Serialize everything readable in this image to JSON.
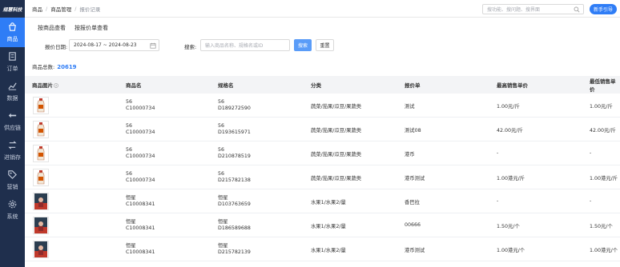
{
  "sidebar": {
    "logo": "规慧科技",
    "items": [
      {
        "label": "商品",
        "icon": "shopping-bag-icon",
        "active": true
      },
      {
        "label": "订单",
        "icon": "order-icon",
        "active": false
      },
      {
        "label": "数据",
        "icon": "chart-line-icon",
        "active": false
      },
      {
        "label": "供应链",
        "icon": "supply-chain-icon",
        "active": false
      },
      {
        "label": "进销存",
        "icon": "inventory-icon",
        "active": false
      },
      {
        "label": "营销",
        "icon": "tag-icon",
        "active": false
      },
      {
        "label": "系统",
        "icon": "gear-icon",
        "active": false
      }
    ]
  },
  "breadcrumb": {
    "items": [
      "商品",
      "商品管理",
      "报价记录"
    ],
    "separator": "/"
  },
  "topbar": {
    "search_placeholder": "搜功能、搜问题、搜界面",
    "guide_button": "新手引导"
  },
  "tabs": [
    "按商品查看",
    "按报价单查看"
  ],
  "filter": {
    "date_label": "报价日期:",
    "date_value": "2024-08-17 ~ 2024-08-23",
    "search_label": "搜索:",
    "search_placeholder": "输入商品名称、规格名或ID",
    "search_button": "搜索",
    "reset_button": "重置"
  },
  "total": {
    "label": "商品总数:",
    "value": "20619"
  },
  "table": {
    "headers": [
      "商品图片",
      "商品名",
      "规格名",
      "分类",
      "报价单",
      "最高销售单价",
      "最低销售单价"
    ],
    "rows": [
      {
        "image": "bottle",
        "name": "56",
        "code": "C10000734",
        "spec": "56",
        "spec_code": "D189272590",
        "category": "蔬菜/茄果/瓜豆/果蔬类",
        "quote": "测试",
        "max_price": "1.00元/斤",
        "min_price": "1.00元/斤"
      },
      {
        "image": "bottle",
        "name": "56",
        "code": "C10000734",
        "spec": "56",
        "spec_code": "D193615971",
        "category": "蔬菜/茄果/瓜豆/果蔬类",
        "quote": "测试08",
        "max_price": "42.00元/斤",
        "min_price": "42.00元/斤"
      },
      {
        "image": "bottle",
        "name": "56",
        "code": "C10000734",
        "spec": "56",
        "spec_code": "D210878519",
        "category": "蔬菜/茄果/瓜豆/果蔬类",
        "quote": "港币",
        "max_price": "-",
        "min_price": "-"
      },
      {
        "image": "bottle",
        "name": "56",
        "code": "C10000734",
        "spec": "56",
        "spec_code": "D215782138",
        "category": "蔬菜/茄果/瓜豆/果蔬类",
        "quote": "港币测试",
        "max_price": "1.00港元/斤",
        "min_price": "1.00港元/斤"
      },
      {
        "image": "poster",
        "name": "恒星",
        "code": "C10008341",
        "spec": "恒星",
        "spec_code": "D103763659",
        "category": "水果1/水果2/量",
        "quote": "香巴拉",
        "max_price": "-",
        "min_price": "-"
      },
      {
        "image": "poster",
        "name": "恒星",
        "code": "C10008341",
        "spec": "恒星",
        "spec_code": "D186589688",
        "category": "水果1/水果2/量",
        "quote": "00666",
        "max_price": "1.50元/个",
        "min_price": "1.50元/个"
      },
      {
        "image": "poster",
        "name": "恒星",
        "code": "C10008341",
        "spec": "恒星",
        "spec_code": "D215782139",
        "category": "水果1/水果2/量",
        "quote": "港币测试",
        "max_price": "1.00港元/个",
        "min_price": "1.00港元/个"
      }
    ]
  }
}
